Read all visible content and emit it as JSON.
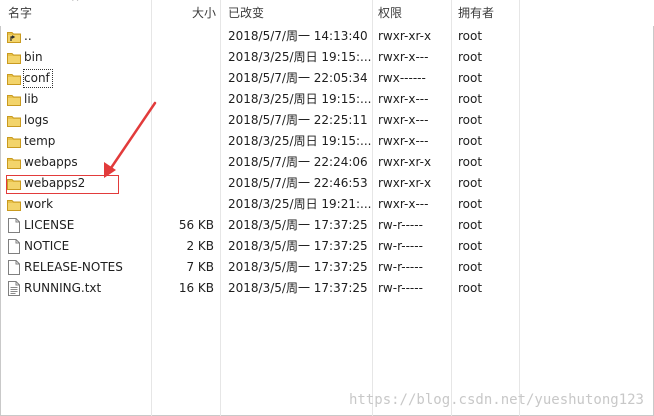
{
  "columns": {
    "name": "名字",
    "size": "大小",
    "modified": "已改变",
    "permissions": "权限",
    "owner": "拥有者"
  },
  "sort_indicator": "^",
  "rows": [
    {
      "type": "up-folder",
      "name": "..",
      "size": "",
      "modified": "2018/5/7/周一 14:13:40",
      "permissions": "rwxr-xr-x",
      "owner": "root"
    },
    {
      "type": "folder",
      "name": "bin",
      "size": "",
      "modified": "2018/3/25/周日 19:15:...",
      "permissions": "rwxr-x---",
      "owner": "root"
    },
    {
      "type": "folder",
      "name": "conf",
      "size": "",
      "modified": "2018/5/7/周一 22:05:34",
      "permissions": "rwx------",
      "owner": "root"
    },
    {
      "type": "folder",
      "name": "lib",
      "size": "",
      "modified": "2018/3/25/周日 19:15:...",
      "permissions": "rwxr-x---",
      "owner": "root"
    },
    {
      "type": "folder",
      "name": "logs",
      "size": "",
      "modified": "2018/5/7/周一 22:25:11",
      "permissions": "rwxr-x---",
      "owner": "root"
    },
    {
      "type": "folder",
      "name": "temp",
      "size": "",
      "modified": "2018/3/25/周日 19:15:...",
      "permissions": "rwxr-x---",
      "owner": "root"
    },
    {
      "type": "folder",
      "name": "webapps",
      "size": "",
      "modified": "2018/5/7/周一 22:24:06",
      "permissions": "rwxr-xr-x",
      "owner": "root"
    },
    {
      "type": "folder",
      "name": "webapps2",
      "size": "",
      "modified": "2018/5/7/周一 22:46:53",
      "permissions": "rwxr-xr-x",
      "owner": "root"
    },
    {
      "type": "folder",
      "name": "work",
      "size": "",
      "modified": "2018/3/25/周日 19:21:...",
      "permissions": "rwxr-x---",
      "owner": "root"
    },
    {
      "type": "file",
      "name": "LICENSE",
      "size": "56 KB",
      "modified": "2018/3/5/周一 17:37:25",
      "permissions": "rw-r-----",
      "owner": "root"
    },
    {
      "type": "file",
      "name": "NOTICE",
      "size": "2 KB",
      "modified": "2018/3/5/周一 17:37:25",
      "permissions": "rw-r-----",
      "owner": "root"
    },
    {
      "type": "file",
      "name": "RELEASE-NOTES",
      "size": "7 KB",
      "modified": "2018/3/5/周一 17:37:25",
      "permissions": "rw-r-----",
      "owner": "root"
    },
    {
      "type": "textfile",
      "name": "RUNNING.txt",
      "size": "16 KB",
      "modified": "2018/3/5/周一 17:37:25",
      "permissions": "rw-r-----",
      "owner": "root"
    }
  ],
  "watermark": "https://blog.csdn.net/yueshutong123",
  "colors": {
    "folder": "#e8c24a",
    "annotation": "#e23b3b"
  },
  "icons": {
    "up-folder": "up-folder-icon",
    "folder": "folder-icon",
    "file": "file-icon",
    "textfile": "text-file-icon"
  }
}
